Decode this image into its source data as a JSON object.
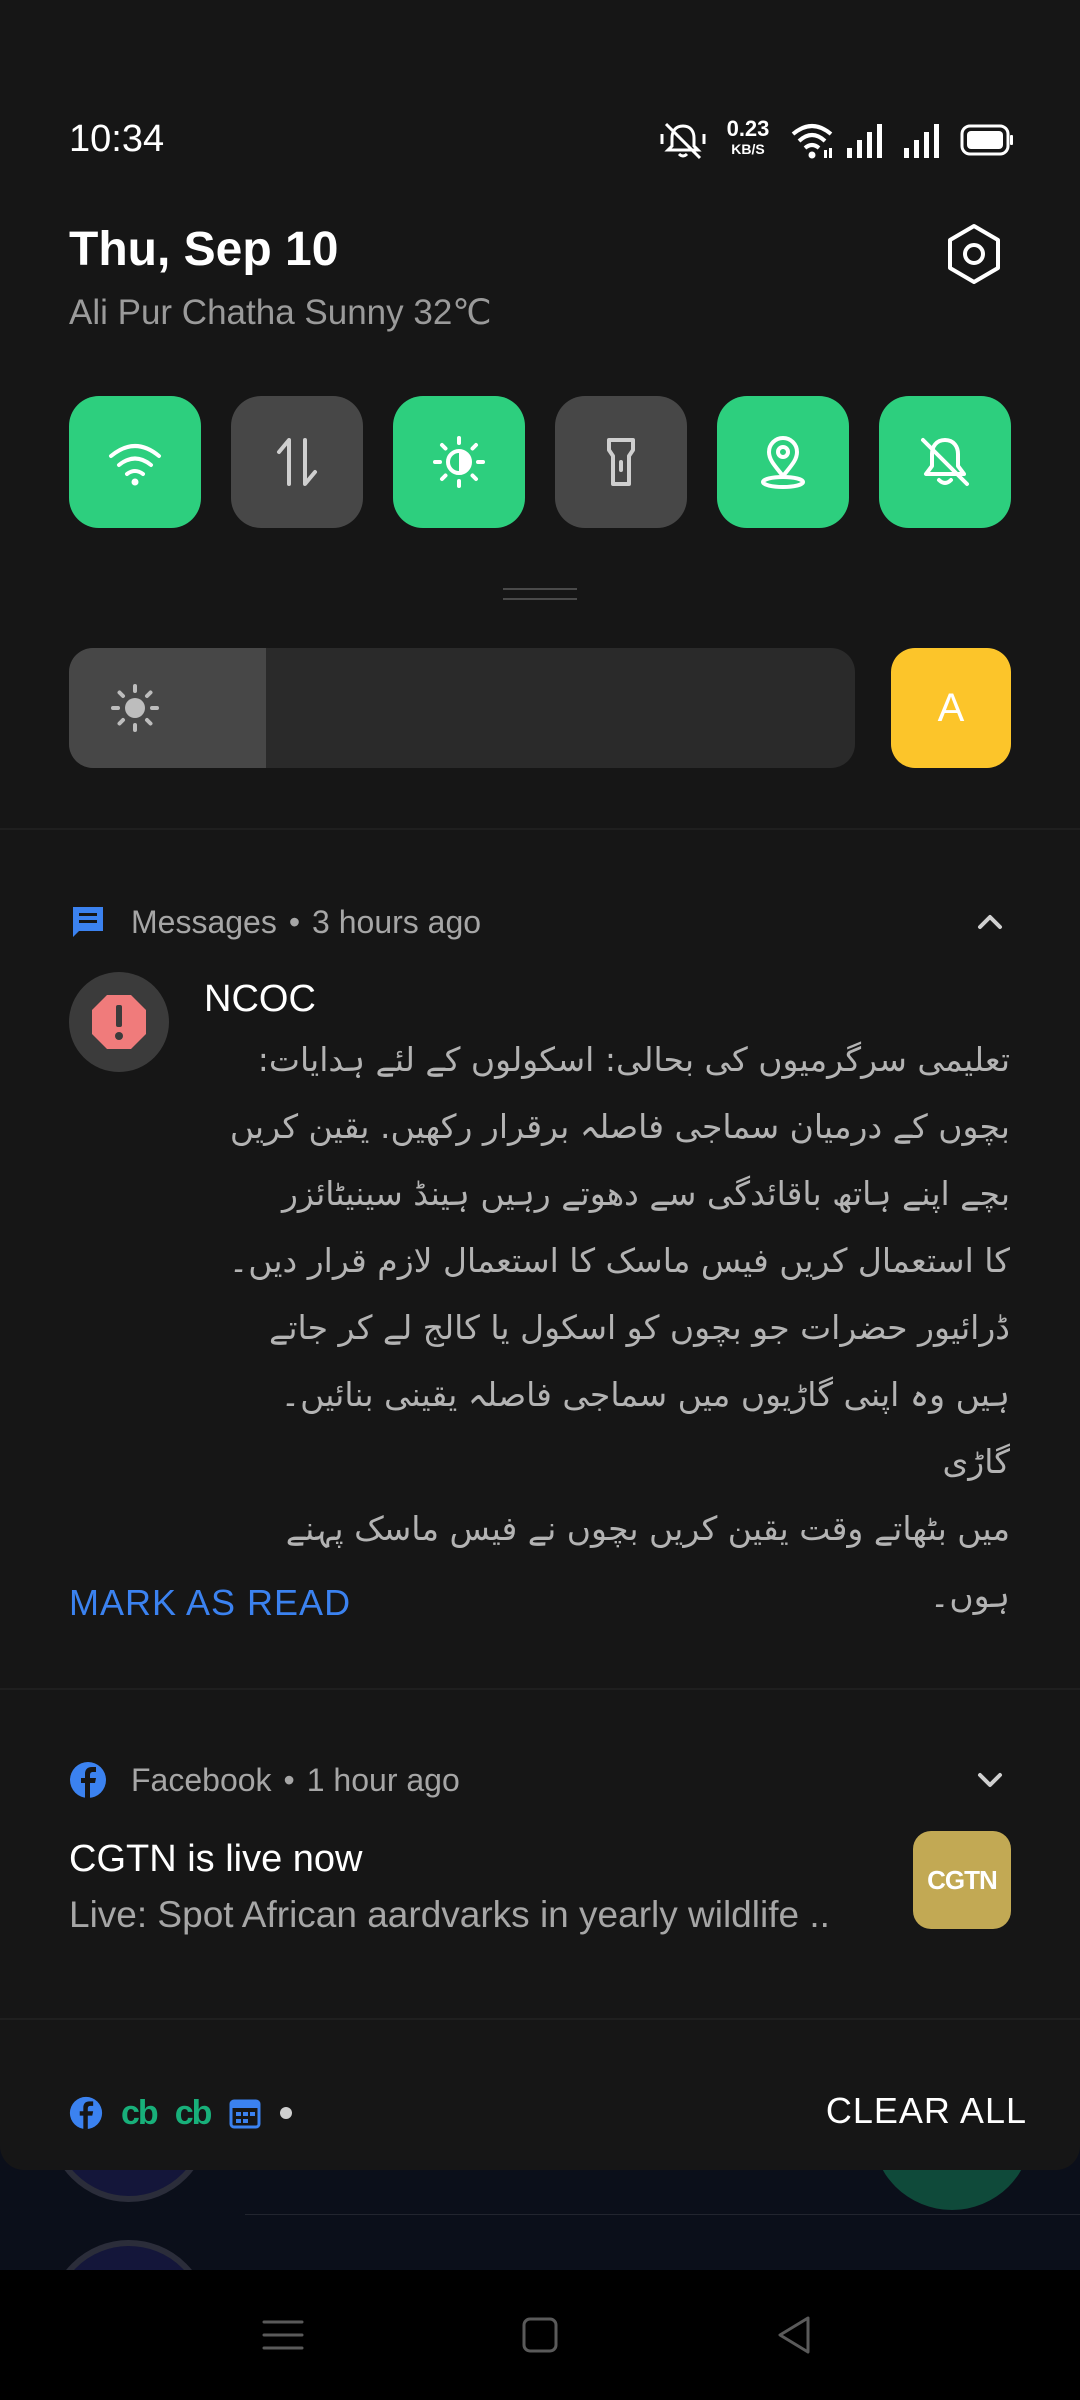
{
  "status_bar": {
    "time": "10:34",
    "net_speed_value": "0.23",
    "net_speed_unit": "KB/S",
    "icons": [
      "mute-bell-icon",
      "wifi-icon",
      "signal-icon",
      "signal-icon",
      "battery-icon"
    ]
  },
  "header": {
    "date": "Thu, Sep 10",
    "weather": "Ali Pur Chatha Sunny 32℃",
    "settings_icon": "gear-icon"
  },
  "quick_toggles": [
    {
      "name": "wifi",
      "icon": "wifi-icon",
      "on": true
    },
    {
      "name": "mobile-data",
      "icon": "data-arrows-icon",
      "on": false
    },
    {
      "name": "dark-mode",
      "icon": "brightness-mode-icon",
      "on": true
    },
    {
      "name": "flashlight",
      "icon": "flashlight-icon",
      "on": false
    },
    {
      "name": "location",
      "icon": "location-pin-icon",
      "on": true
    },
    {
      "name": "silent",
      "icon": "bell-off-icon",
      "on": true
    }
  ],
  "brightness": {
    "level": 0.25,
    "auto_label": "A"
  },
  "colors": {
    "toggle_on": "#2dcf7e",
    "toggle_off": "#474747",
    "accent_blue": "#3b82f0",
    "auto_yellow": "#fcc52a",
    "cgtn_gold": "#c2a954"
  },
  "messages_notification": {
    "app": "Messages",
    "time": "3 hours ago",
    "sender": "NCOC",
    "body": "تعلیمی سرگرمیوں کی بحالی: اسکولوں کے لئے ہدایات:\nبچوں کے درمیان سماجی فاصلہ برقرار رکھیں. یقین کریں\nبچے اپنے ہاتھ باقائدگی سے دھوتے رہیں ہینڈ سینیٹائزر\nکا استعمال کریں  فیس ماسک کا استعمال لازم قرار دیں۔\nڈرائیور حضرات جو بچوں کو اسکول یا کالج لے کر جاتے\nہیں وہ اپنی گاڑیوں میں سماجی فاصلہ یقینی بنائیں۔ گاڑی\nمیں بٹھاتے وقت یقین کریں بچوں نے فیس ماسک پہنے\nہوں۔",
    "action": "MARK AS READ"
  },
  "facebook_notification": {
    "app": "Facebook",
    "time": "1 hour ago",
    "title": "CGTN is live now",
    "text": "Live: Spot African aardvarks in yearly wildlife ..",
    "thumbnail_text": "CGTN"
  },
  "footer": {
    "cb1": "cb",
    "cb2": "cb",
    "clear_all": "CLEAR ALL"
  }
}
